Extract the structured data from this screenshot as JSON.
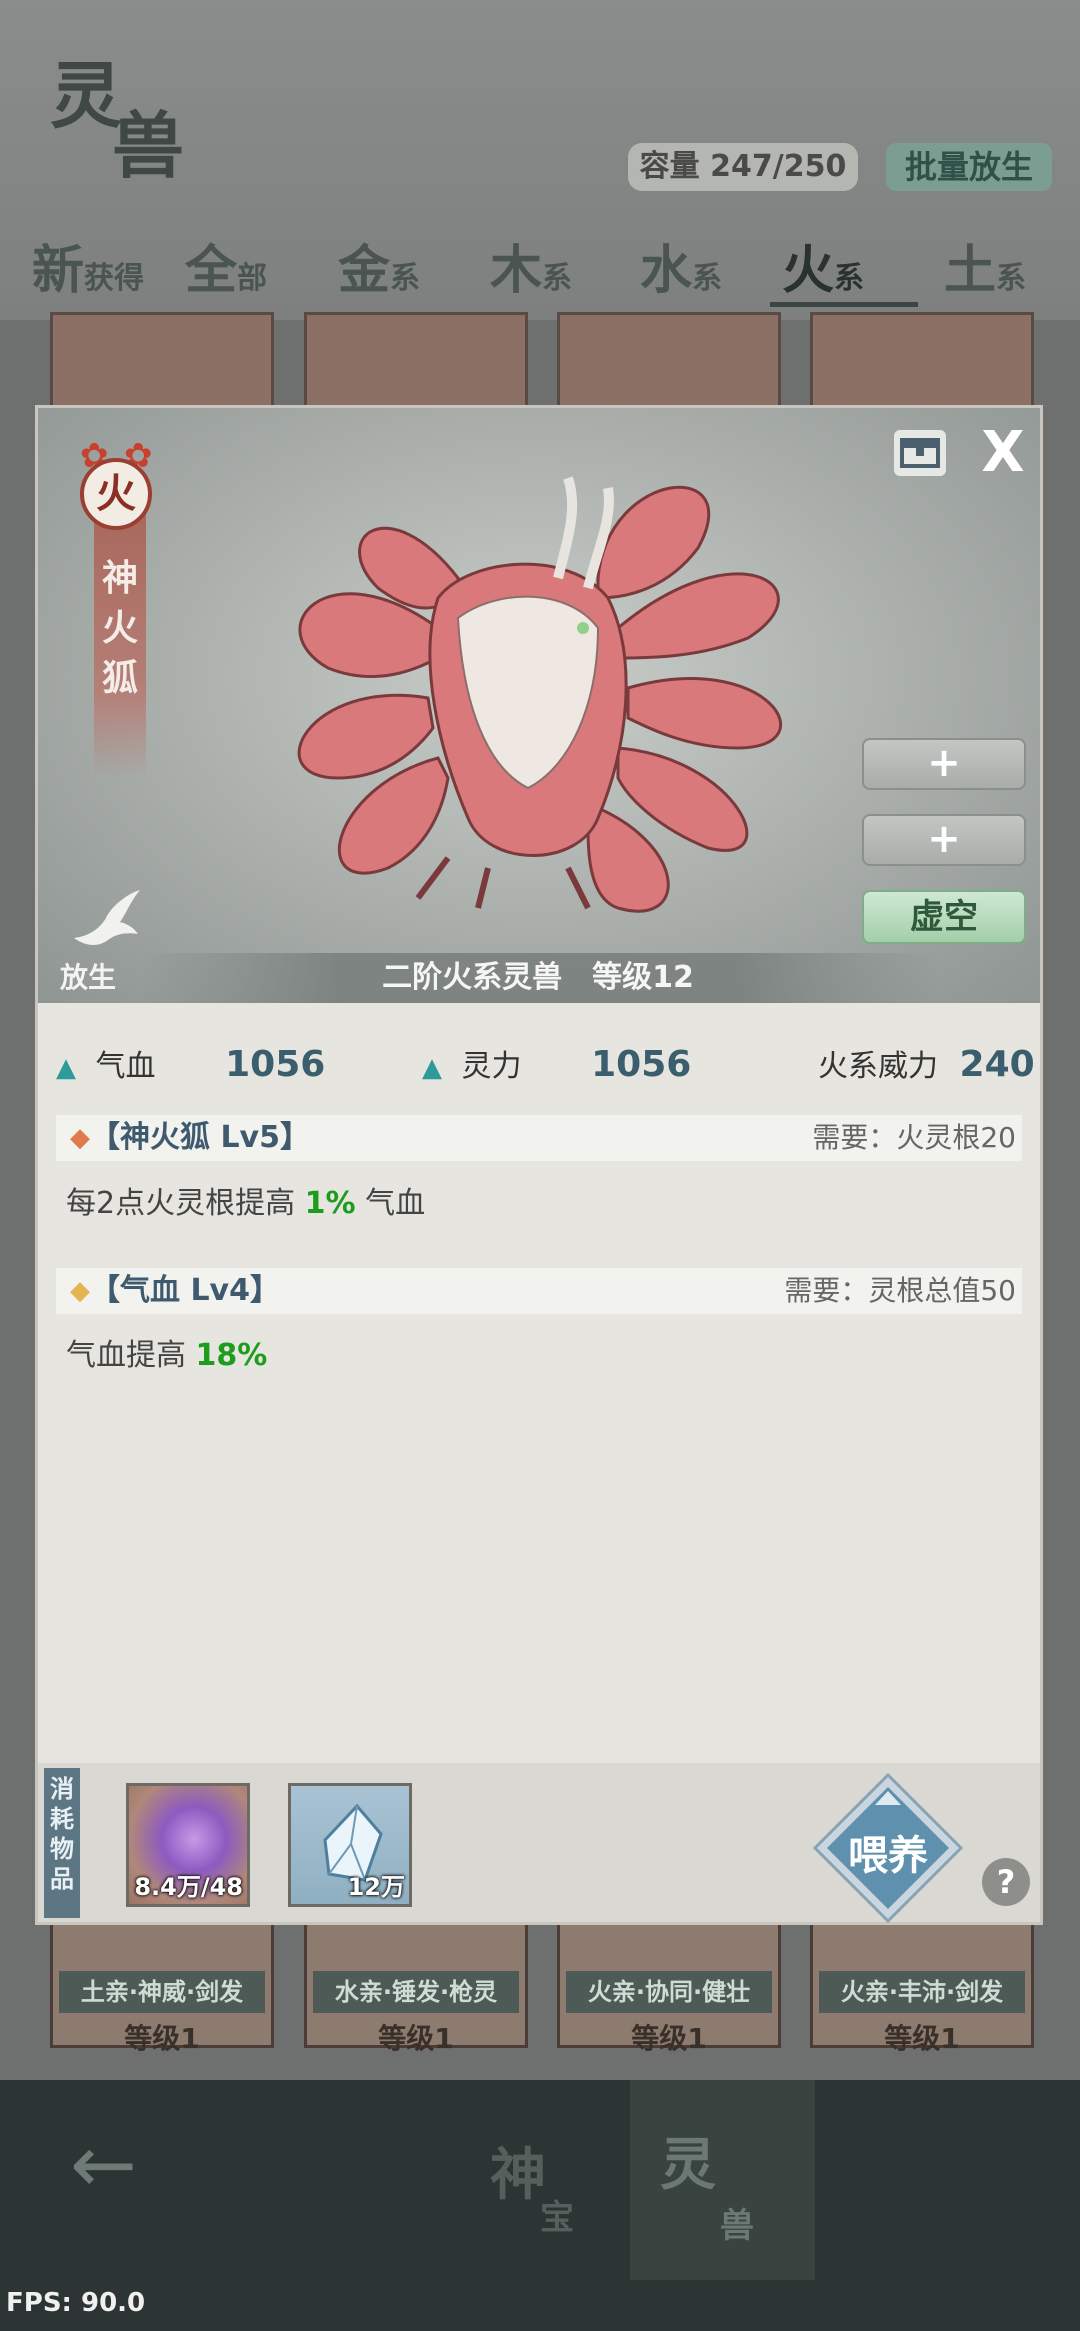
{
  "header": {
    "logo_char1": "灵",
    "logo_char2": "兽",
    "capacity": "容量 247/250",
    "batch_release": "批量放生"
  },
  "filter_tabs": [
    {
      "big": "新",
      "small": "获得"
    },
    {
      "big": "全",
      "small": "部"
    },
    {
      "big": "金",
      "small": "系"
    },
    {
      "big": "木",
      "small": "系"
    },
    {
      "big": "水",
      "small": "系"
    },
    {
      "big": "火",
      "small": "系"
    },
    {
      "big": "土",
      "small": "系"
    }
  ],
  "active_tab": "火系",
  "background_cards": [
    {
      "tags": "土亲·神威·剑发",
      "level": "等级1"
    },
    {
      "tags": "水亲·锤发·枪灵",
      "level": "等级1"
    },
    {
      "tags": "火亲·协同·健壮",
      "level": "等级1"
    },
    {
      "tags": "火亲·丰沛·剑发",
      "level": "等级1"
    }
  ],
  "modal": {
    "element": "火",
    "beast_name": "神火狐",
    "release_label": "放生",
    "slot_buttons": [
      "+",
      "+"
    ],
    "void_button": "虚空",
    "rank_level": "二阶火系灵兽　等级12",
    "stats": {
      "hp_label": "气血",
      "hp_value": "1056",
      "spirit_label": "灵力",
      "spirit_value": "1056",
      "fire_power_label": "火系威力",
      "fire_power_value": "240"
    },
    "skills": [
      {
        "title": "【神火狐 Lv5】",
        "requirement": "需要：火灵根20",
        "desc_prefix": "每2点火灵根提高 ",
        "desc_value": "1%",
        "desc_suffix": " 气血",
        "diamond_color": "#e07a4a"
      },
      {
        "title": "【气血 Lv4】",
        "requirement": "需要：灵根总值50",
        "desc_prefix": "气血提高 ",
        "desc_value": "18%",
        "desc_suffix": "",
        "diamond_color": "#e4b450"
      }
    ],
    "consume_label": "消耗物品",
    "items": [
      {
        "name": "purple-orb",
        "qty": "8.4万/48"
      },
      {
        "name": "spirit-crystal",
        "qty": "12万"
      }
    ],
    "feed_button": "喂养",
    "help": "?"
  },
  "bottom_nav": {
    "shenbao_big": "神",
    "shenbao_small": "宝",
    "lingshou_big": "灵",
    "lingshou_small": "兽"
  },
  "fps": "FPS: 90.0"
}
